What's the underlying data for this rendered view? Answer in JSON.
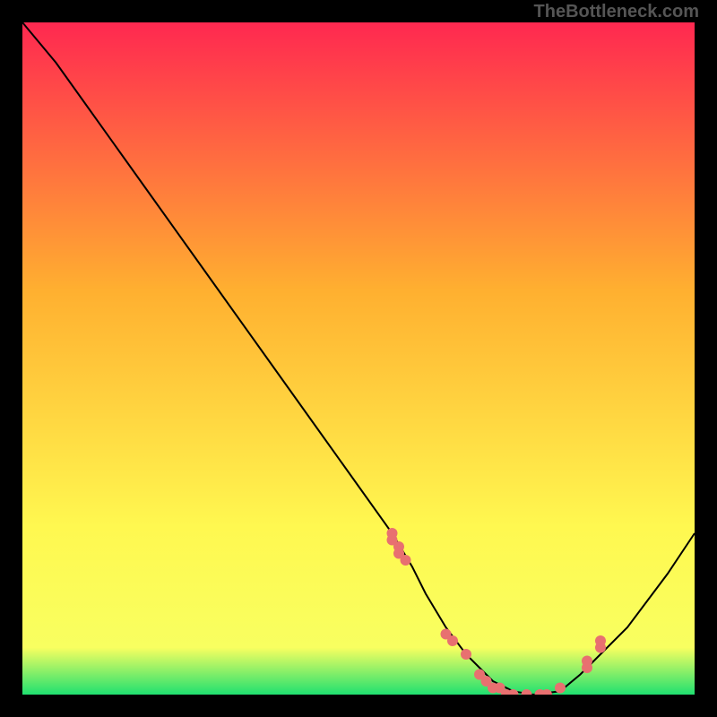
{
  "watermark": "TheBottleneck.com",
  "chart_data": {
    "type": "line",
    "title": "",
    "xlabel": "",
    "ylabel": "",
    "xlim": [
      0,
      100
    ],
    "ylim": [
      0,
      100
    ],
    "background_gradient": {
      "top": "#ff2850",
      "mid_upper": "#ffb030",
      "mid_lower": "#fff850",
      "bottom": "#20e070"
    },
    "series": [
      {
        "name": "bottleneck-curve",
        "type": "line",
        "color": "#000000",
        "x": [
          0,
          5,
          10,
          15,
          20,
          25,
          30,
          35,
          40,
          45,
          50,
          55,
          58,
          60,
          63,
          66,
          70,
          73,
          76,
          80,
          83,
          86,
          90,
          93,
          96,
          100
        ],
        "y": [
          100,
          94,
          87,
          80,
          73,
          66,
          59,
          52,
          45,
          38,
          31,
          24,
          19,
          15,
          10,
          6,
          2,
          0.5,
          0,
          0.5,
          3,
          6,
          10,
          14,
          18,
          24
        ]
      },
      {
        "name": "markers",
        "type": "scatter",
        "color": "#e87070",
        "x": [
          55,
          55,
          56,
          56,
          57,
          63,
          64,
          66,
          68,
          69,
          70,
          71,
          72,
          73,
          75,
          77,
          78,
          80,
          84,
          84,
          86,
          86
        ],
        "y": [
          24,
          23,
          22,
          21,
          20,
          9,
          8,
          6,
          3,
          2,
          1,
          1,
          0,
          0,
          0,
          0,
          0,
          1,
          4,
          5,
          7,
          8
        ]
      }
    ]
  }
}
